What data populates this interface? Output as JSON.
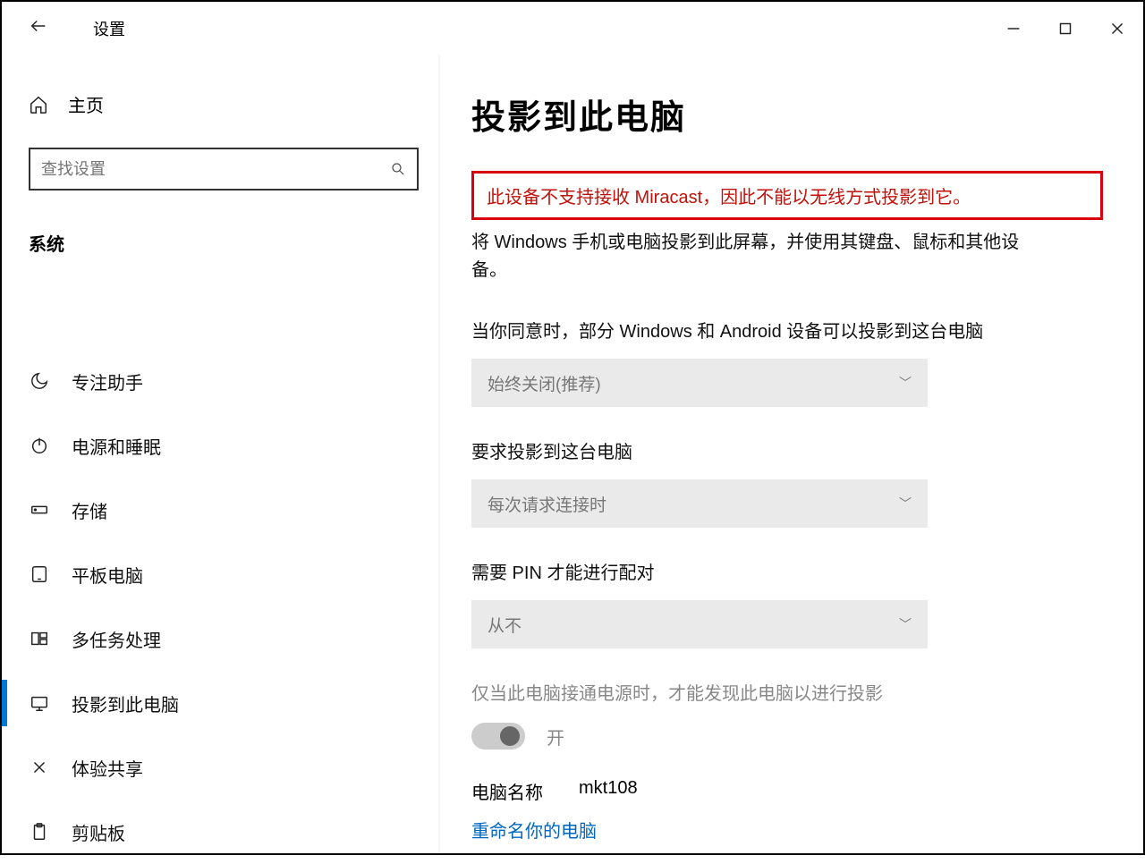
{
  "titlebar": {
    "app_title": "设置"
  },
  "sidebar": {
    "home": "主页",
    "search_placeholder": "查找设置",
    "section_label": "系统",
    "items": [
      {
        "label": "专注助手",
        "icon": "moon-icon"
      },
      {
        "label": "电源和睡眠",
        "icon": "power-icon"
      },
      {
        "label": "存储",
        "icon": "storage-icon"
      },
      {
        "label": "平板电脑",
        "icon": "tablet-icon"
      },
      {
        "label": "多任务处理",
        "icon": "multitask-icon"
      },
      {
        "label": "投影到此电脑",
        "icon": "project-icon"
      },
      {
        "label": "体验共享",
        "icon": "share-icon"
      },
      {
        "label": "剪贴板",
        "icon": "clipboard-icon"
      }
    ],
    "selected_index": 5
  },
  "content": {
    "page_title": "投影到此电脑",
    "alert_text": "此设备不支持接收 Miracast，因此不能以无线方式投影到它。",
    "description": "将 Windows 手机或电脑投影到此屏幕，并使用其键盘、鼠标和其他设备。",
    "settings": [
      {
        "label": "当你同意时，部分 Windows 和 Android 设备可以投影到这台电脑",
        "value": "始终关闭(推荐)"
      },
      {
        "label": "要求投影到这台电脑",
        "value": "每次请求连接时"
      },
      {
        "label": "需要 PIN 才能进行配对",
        "value": "从不"
      }
    ],
    "power_only_label": "仅当此电脑接通电源时，才能发现此电脑以进行投影",
    "toggle_state": "开",
    "pc_name_label": "电脑名称",
    "pc_name_value": "mkt108",
    "rename_link": "重命名你的电脑"
  }
}
